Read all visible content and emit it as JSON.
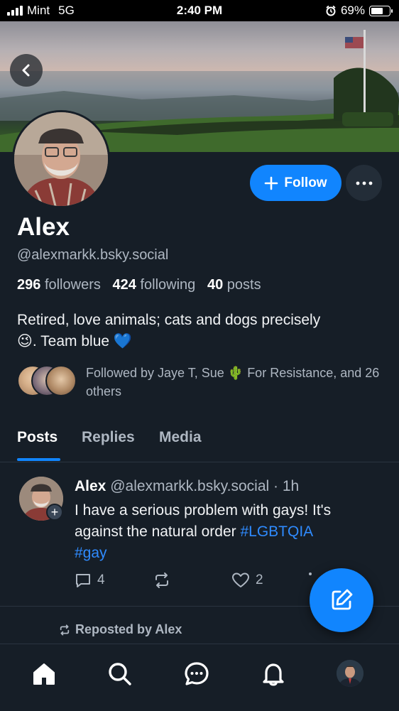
{
  "status_bar": {
    "carrier": "Mint",
    "network": "5G",
    "time": "2:40 PM",
    "battery": "69%",
    "battery_level": 0.69
  },
  "profile": {
    "display_name": "Alex",
    "handle": "@alexmarkk.bsky.social",
    "follow_label": "Follow",
    "stats": {
      "followers_count": "296",
      "followers_label": "followers",
      "following_count": "424",
      "following_label": "following",
      "posts_count": "40",
      "posts_label": "posts"
    },
    "bio_line1": "Retired, love animals; cats and dogs precisely",
    "bio_line2": "😉. Team blue 💙",
    "followed_by": "Followed by Jaye T, Sue 🌵 For Resistance, and 26 others"
  },
  "tabs": [
    {
      "label": "Posts",
      "active": true
    },
    {
      "label": "Replies",
      "active": false
    },
    {
      "label": "Media",
      "active": false
    }
  ],
  "post": {
    "author": "Alex",
    "handle": "@alexmarkk.bsky.social",
    "time": "1h",
    "text_main": "I have a serious problem with gays! It's against the natural order ",
    "hashtag1": "#LGBTQIA",
    "hashtag2": "#gay",
    "reply_count": "4",
    "like_count": "2"
  },
  "reposted_by": "Reposted by Alex",
  "colors": {
    "accent": "#1185fe",
    "background": "#161e27",
    "muted_text": "#aeb7c2",
    "hashtag": "#2f8bff"
  },
  "icons": {
    "back": "chevron-left-icon",
    "follow": "plus-icon",
    "more": "ellipsis-icon",
    "reply": "comment-icon",
    "repost": "repost-icon",
    "like": "heart-icon",
    "compose": "compose-icon",
    "nav": [
      "home-icon",
      "search-icon",
      "chat-icon",
      "bell-icon",
      "profile-avatar"
    ]
  }
}
